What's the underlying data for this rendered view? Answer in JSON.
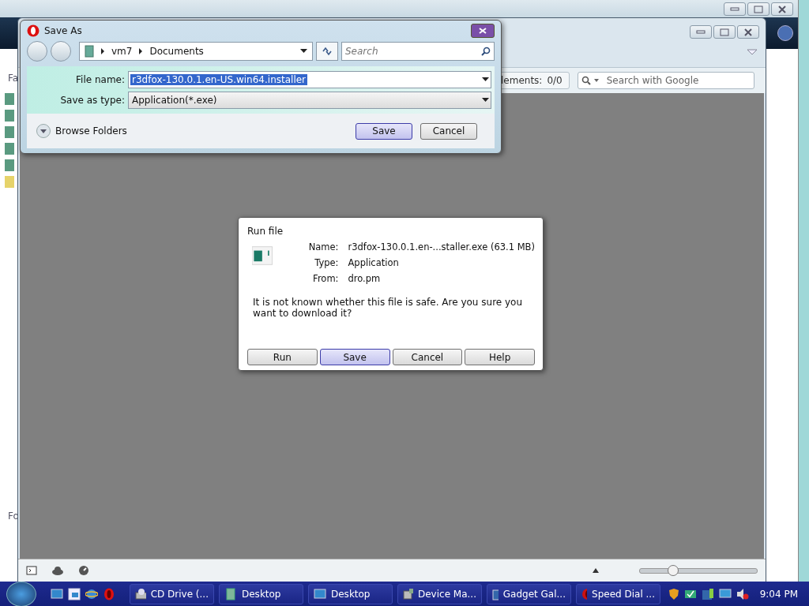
{
  "back_window": {
    "side_labels": [
      "Fa",
      "Fo"
    ]
  },
  "browser": {
    "elements_label": "lements:",
    "elements_count": "0/0",
    "search": {
      "placeholder": "Search with Google"
    },
    "zoom": {
      "level": 0.28
    }
  },
  "save_as": {
    "title": "Save As",
    "path": [
      "vm7",
      "Documents"
    ],
    "search": {
      "placeholder": "Search"
    },
    "fields": [
      {
        "label": "File name:",
        "value": "r3dfox-130.0.1.en-US.win64.installer",
        "selected": true
      },
      {
        "label": "Save as type:",
        "value": "Application(*.exe)",
        "selected": false
      }
    ],
    "browse": "Browse Folders",
    "buttons": [
      {
        "label": "Save",
        "default": true
      },
      {
        "label": "Cancel",
        "default": false
      }
    ]
  },
  "run_file": {
    "title": "Run file",
    "details": [
      {
        "label": "Name:",
        "value": "r3dfox-130.0.1.en-...staller.exe (63.1 MB)"
      },
      {
        "label": "Type:",
        "value": "Application"
      },
      {
        "label": "From:",
        "value": "dro.pm"
      }
    ],
    "message": "It is not known whether this file is safe. Are you sure you want to download it?",
    "buttons": [
      {
        "label": "Run",
        "default": false
      },
      {
        "label": "Save",
        "default": true
      },
      {
        "label": "Cancel",
        "default": false
      },
      {
        "label": "Help",
        "default": false
      }
    ]
  },
  "taskbar": {
    "items": [
      {
        "label": "CD Drive (...",
        "kind": "drive"
      },
      {
        "label": "Desktop",
        "kind": "folder"
      },
      {
        "label": "Desktop",
        "kind": "desktop"
      },
      {
        "label": "Device Ma...",
        "kind": "device"
      },
      {
        "label": "Gadget Gal...",
        "kind": "gadget"
      },
      {
        "label": "Speed Dial ...",
        "kind": "browser"
      }
    ],
    "clock": "9:04 PM"
  }
}
